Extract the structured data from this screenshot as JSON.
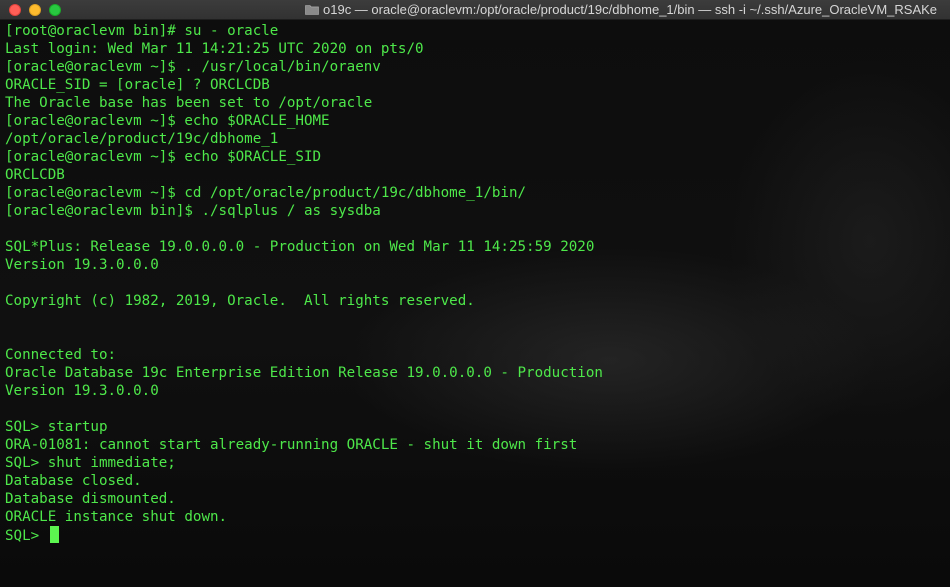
{
  "window": {
    "title": "o19c — oracle@oraclevm:/opt/oracle/product/19c/dbhome_1/bin — ssh -i ~/.ssh/Azure_OracleVM_RSAKe",
    "icon": "folder-icon"
  },
  "terminal": {
    "text_color": "#4ee84a",
    "background": "#0c0c0c",
    "lines": [
      "[root@oraclevm bin]# su - oracle",
      "Last login: Wed Mar 11 14:21:25 UTC 2020 on pts/0",
      "[oracle@oraclevm ~]$ . /usr/local/bin/oraenv",
      "ORACLE_SID = [oracle] ? ORCLCDB",
      "The Oracle base has been set to /opt/oracle",
      "[oracle@oraclevm ~]$ echo $ORACLE_HOME",
      "/opt/oracle/product/19c/dbhome_1",
      "[oracle@oraclevm ~]$ echo $ORACLE_SID",
      "ORCLCDB",
      "[oracle@oraclevm ~]$ cd /opt/oracle/product/19c/dbhome_1/bin/",
      "[oracle@oraclevm bin]$ ./sqlplus / as sysdba",
      "",
      "SQL*Plus: Release 19.0.0.0.0 - Production on Wed Mar 11 14:25:59 2020",
      "Version 19.3.0.0.0",
      "",
      "Copyright (c) 1982, 2019, Oracle.  All rights reserved.",
      "",
      "",
      "Connected to:",
      "Oracle Database 19c Enterprise Edition Release 19.0.0.0.0 - Production",
      "Version 19.3.0.0.0",
      "",
      "SQL> startup",
      "ORA-01081: cannot start already-running ORACLE - shut it down first",
      "SQL> shut immediate;",
      "Database closed.",
      "Database dismounted.",
      "ORACLE instance shut down."
    ],
    "prompt": "SQL> "
  }
}
